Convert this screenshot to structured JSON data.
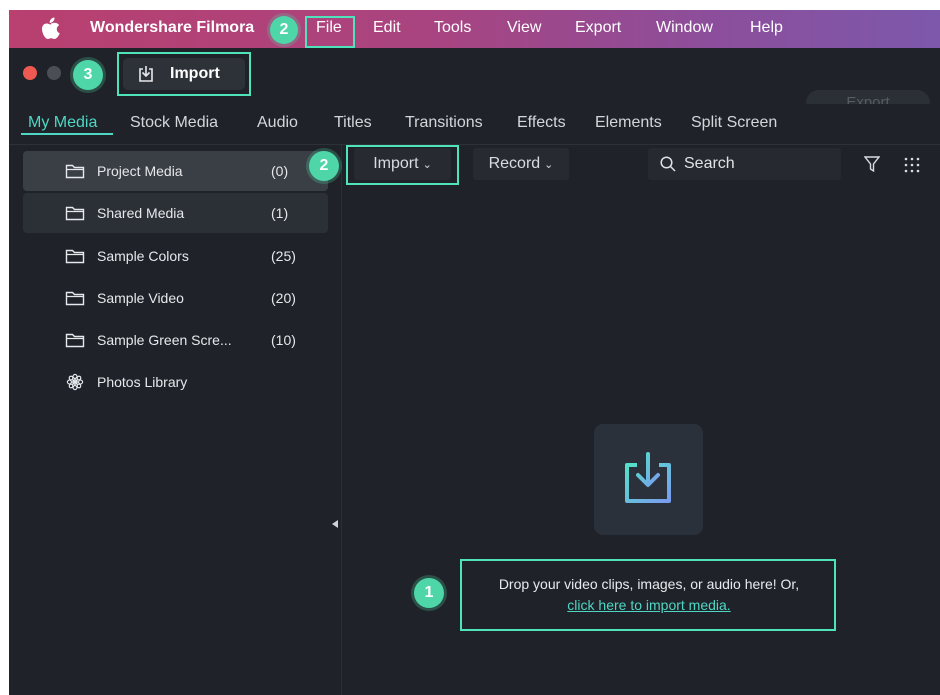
{
  "menubar": {
    "app_name": "Wondershare Filmora",
    "items": [
      "File",
      "Edit",
      "Tools",
      "View",
      "Export",
      "Window",
      "Help"
    ]
  },
  "titlebar": {
    "import_label": "Import"
  },
  "tabs": {
    "items": [
      "My Media",
      "Stock Media",
      "Audio",
      "Titles",
      "Transitions",
      "Effects",
      "Elements",
      "Split Screen"
    ],
    "export_label": "Export"
  },
  "sidebar": {
    "items": [
      {
        "label": "Project Media",
        "count": "(0)"
      },
      {
        "label": "Shared Media",
        "count": "(1)"
      },
      {
        "label": "Sample Colors",
        "count": "(25)"
      },
      {
        "label": "Sample Video",
        "count": "(20)"
      },
      {
        "label": "Sample Green Scre...",
        "count": "(10)"
      },
      {
        "label": "Photos Library"
      }
    ]
  },
  "toolbar": {
    "import_label": "Import",
    "record_label": "Record",
    "search_placeholder": "Search"
  },
  "dropzone": {
    "line1": "Drop your video clips, images, or audio here! Or,",
    "link": "click here to import media."
  },
  "steps": {
    "badge1": "1",
    "badge2": "2",
    "badge3": "3"
  },
  "colors": {
    "accent": "#4fd6c4",
    "highlight": "#4fe3b9",
    "badge": "#4fd6a8"
  }
}
